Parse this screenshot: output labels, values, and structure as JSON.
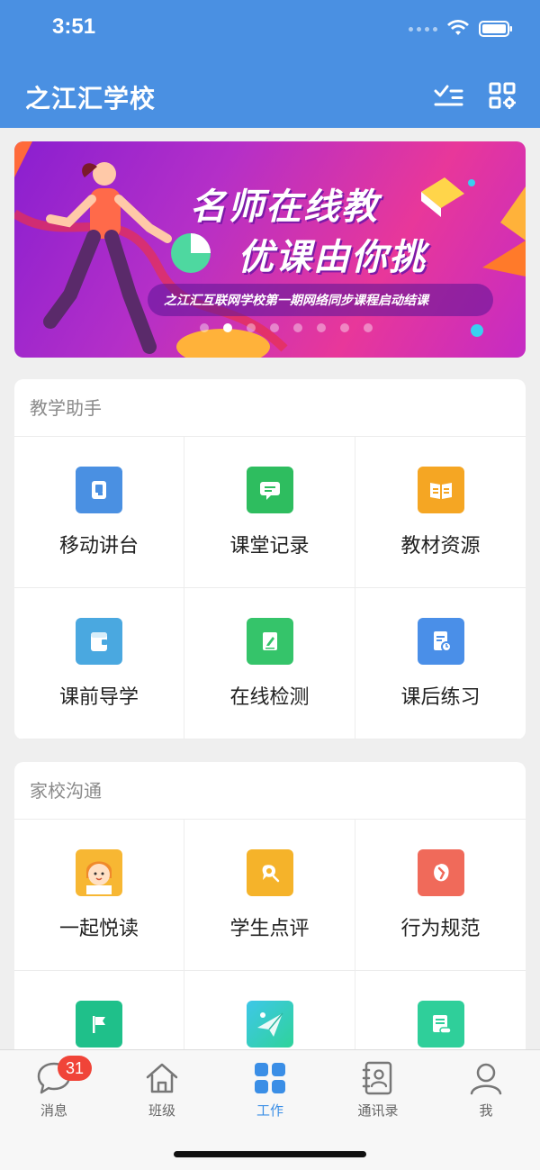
{
  "status_bar": {
    "time": "3:51"
  },
  "header": {
    "title": "之江汇学校",
    "icons": [
      "checklist-icon",
      "grid-settings-icon"
    ]
  },
  "banner": {
    "headline_line1": "名师在线教",
    "headline_line2": "优课由你挑",
    "subtitle": "之江汇互联网学校第一期网络同步课程启动结课",
    "slide_count": 8,
    "active_slide": 2
  },
  "teaching_section": {
    "title": "教学助手",
    "items": [
      {
        "label": "移动讲台",
        "icon": "mobile-podium-icon",
        "color": "#4a90e2"
      },
      {
        "label": "课堂记录",
        "icon": "classroom-record-icon",
        "color": "#2ebd5f"
      },
      {
        "label": "教材资源",
        "icon": "textbook-resource-icon",
        "color": "#f5a623"
      },
      {
        "label": "课前导学",
        "icon": "pre-class-guide-icon",
        "color": "#4aa8e0"
      },
      {
        "label": "在线检测",
        "icon": "online-test-icon",
        "color": "#35c46a"
      },
      {
        "label": "课后练习",
        "icon": "homework-practice-icon",
        "color": "#4a8fe8"
      }
    ]
  },
  "home_school_section": {
    "title": "家校沟通",
    "items": [
      {
        "label": "一起悦读",
        "icon": "reading-together-icon",
        "color": "#f7b733"
      },
      {
        "label": "学生点评",
        "icon": "student-review-icon",
        "color": "#f5b32a"
      },
      {
        "label": "行为规范",
        "icon": "behavior-standard-icon",
        "color": "#f06a5a"
      },
      {
        "label": "",
        "icon": "flag-icon",
        "color": "#1fc08a"
      },
      {
        "label": "",
        "icon": "paper-plane-icon",
        "color": "#35c4b0"
      },
      {
        "label": "",
        "icon": "document-icon",
        "color": "#2fcf9a"
      }
    ]
  },
  "tabbar": {
    "tabs": [
      {
        "label": "消息",
        "icon": "chat-bubble-icon"
      },
      {
        "label": "班级",
        "icon": "home-icon"
      },
      {
        "label": "工作",
        "icon": "apps-grid-icon"
      },
      {
        "label": "通讯录",
        "icon": "contacts-book-icon"
      },
      {
        "label": "我",
        "icon": "person-icon"
      }
    ],
    "active": "工作",
    "message_badge": "31"
  }
}
